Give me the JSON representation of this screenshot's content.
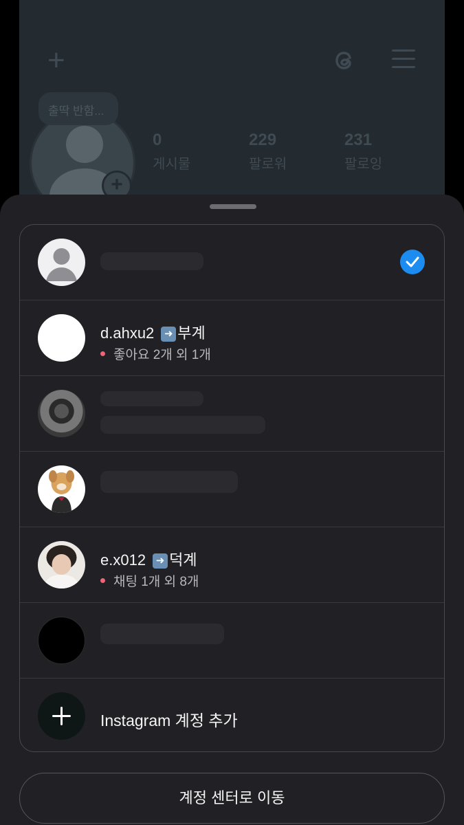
{
  "background_profile": {
    "note": "출딱 반함...",
    "stats": [
      {
        "value": "0",
        "label": "게시물"
      },
      {
        "value": "229",
        "label": "팔로워"
      },
      {
        "value": "231",
        "label": "팔로잉"
      }
    ]
  },
  "accounts": [
    {
      "name": "",
      "tag": "",
      "activity": "",
      "selected": true
    },
    {
      "name": "d.ahxu2",
      "tag": "부계",
      "activity": "좋아요 2개 외 1개",
      "selected": false
    },
    {
      "name": "",
      "tag": "",
      "activity": "",
      "selected": false
    },
    {
      "name": "",
      "tag": "",
      "activity": "",
      "selected": false
    },
    {
      "name": "e.x012",
      "tag": "덕계",
      "activity": "채팅 1개 외 8개",
      "selected": false
    },
    {
      "name": "",
      "tag": "",
      "activity": "",
      "selected": false
    }
  ],
  "add_account_label": "Instagram 계정 추가",
  "account_center_button": "계정 센터로 이동",
  "colors": {
    "check": "#1d8cf0",
    "activity_dot": "#f0637a",
    "sheet": "#212024"
  }
}
